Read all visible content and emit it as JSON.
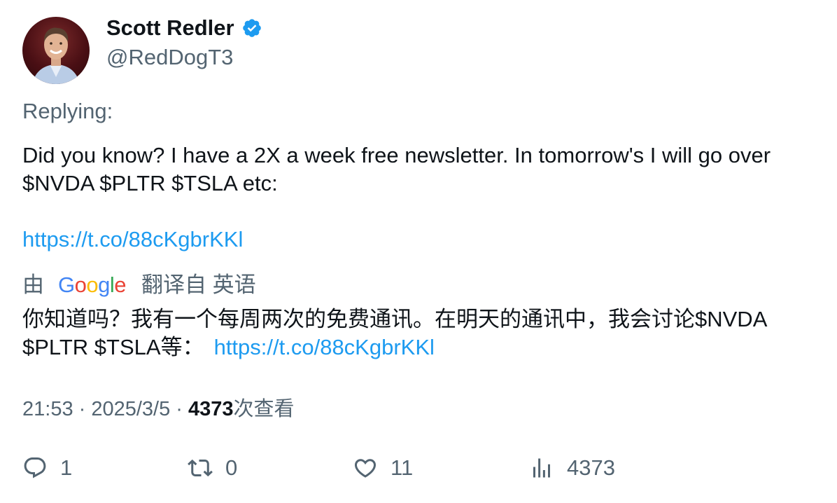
{
  "author": {
    "display_name": "Scott Redler",
    "handle": "@RedDogT3",
    "verified_icon": "verified-badge-icon",
    "avatar_icon": "avatar-photo"
  },
  "reply": {
    "label": "Replying:"
  },
  "tweet": {
    "line1": "Did you know? I have a 2X a week free newsletter. In tomorrow's I will go over",
    "line2": "$NVDA $PLTR $TSLA etc:",
    "link": "https://t.co/88cKgbrKKl"
  },
  "translation": {
    "prefix": "由",
    "provider_letters": [
      "G",
      "o",
      "o",
      "g",
      "l",
      "e"
    ],
    "suffix": "翻译自 英语",
    "line1": "你知道吗？我有一个每周两次的免费通讯。在明天的通讯中，我会讨论$NVDA",
    "line2": "$PLTR $TSLA等：",
    "link": "https://t.co/88cKgbrKKl"
  },
  "meta": {
    "time": "21:53",
    "separator": " · ",
    "date": "2025/3/5",
    "views_count": "4373",
    "views_label": "次查看"
  },
  "actions": {
    "replies": "1",
    "retweets": "0",
    "likes": "11",
    "views": "4373"
  },
  "colors": {
    "link": "#1d9bf0",
    "secondary_text": "#536471",
    "primary_text": "#0f1419",
    "verified": "#1d9bf0"
  }
}
